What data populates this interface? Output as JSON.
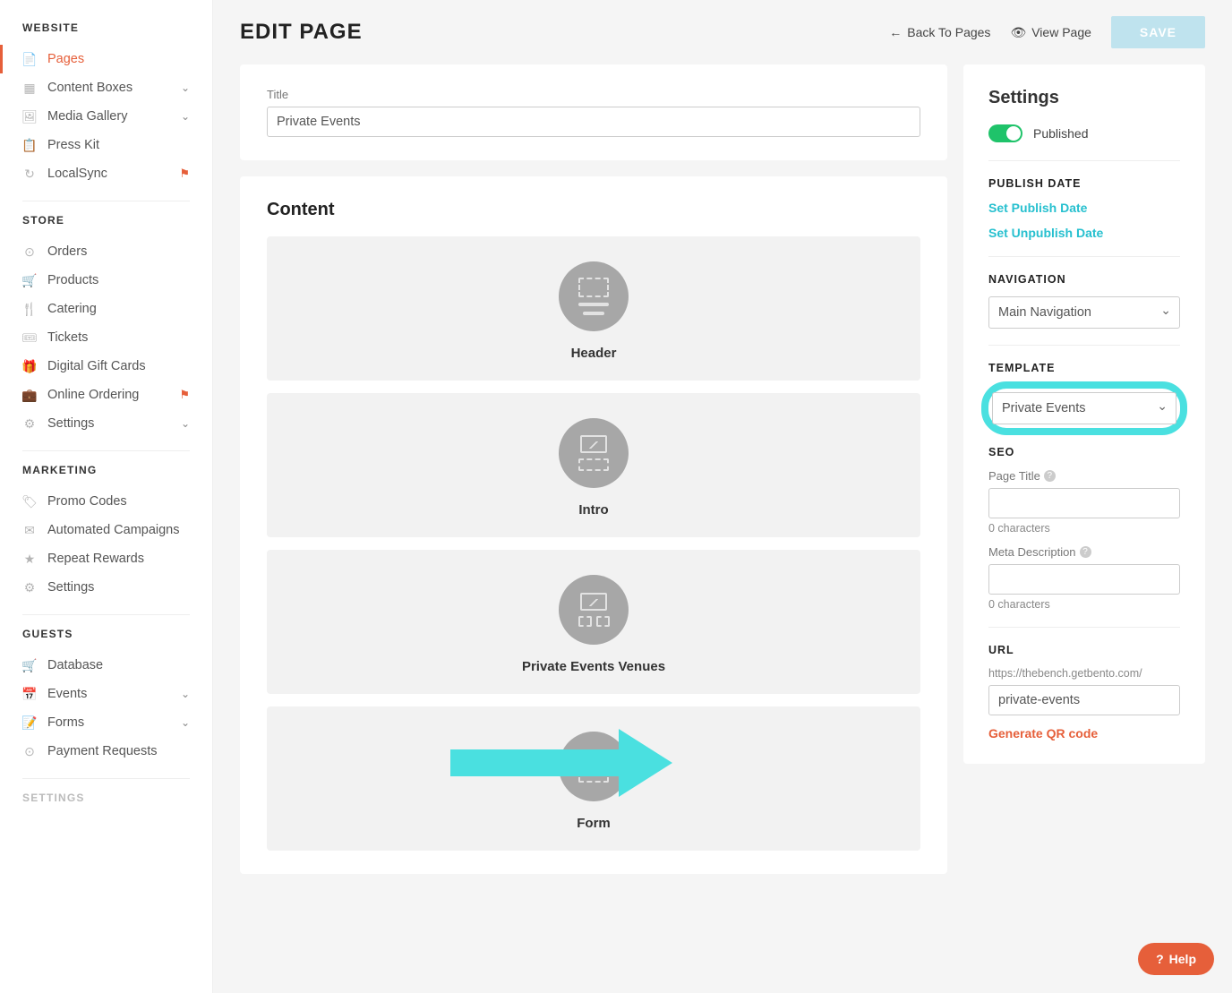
{
  "sidebar": {
    "sections": [
      {
        "heading": "WEBSITE",
        "items": [
          {
            "label": "Pages",
            "icon": "📄",
            "active": true
          },
          {
            "label": "Content Boxes",
            "icon": "▦",
            "chevron": true
          },
          {
            "label": "Media Gallery",
            "icon": "🖼",
            "chevron": true
          },
          {
            "label": "Press Kit",
            "icon": "📋"
          },
          {
            "label": "LocalSync",
            "icon": "↻",
            "flag": true
          }
        ]
      },
      {
        "heading": "STORE",
        "items": [
          {
            "label": "Orders",
            "icon": "⊙"
          },
          {
            "label": "Products",
            "icon": "🛒"
          },
          {
            "label": "Catering",
            "icon": "🍴"
          },
          {
            "label": "Tickets",
            "icon": "🎟"
          },
          {
            "label": "Digital Gift Cards",
            "icon": "🎁"
          },
          {
            "label": "Online Ordering",
            "icon": "💼",
            "flag": true
          },
          {
            "label": "Settings",
            "icon": "⚙",
            "chevron": true
          }
        ]
      },
      {
        "heading": "MARKETING",
        "items": [
          {
            "label": "Promo Codes",
            "icon": "🏷"
          },
          {
            "label": "Automated Campaigns",
            "icon": "✉"
          },
          {
            "label": "Repeat Rewards",
            "icon": "★"
          },
          {
            "label": "Settings",
            "icon": "⚙"
          }
        ]
      },
      {
        "heading": "GUESTS",
        "items": [
          {
            "label": "Database",
            "icon": "🛒"
          },
          {
            "label": "Events",
            "icon": "📅",
            "chevron": true
          },
          {
            "label": "Forms",
            "icon": "📝",
            "chevron": true
          },
          {
            "label": "Payment Requests",
            "icon": "⊙"
          }
        ]
      },
      {
        "heading": "SETTINGS",
        "items": [],
        "muted": true
      }
    ]
  },
  "header": {
    "title": "EDIT PAGE",
    "back": "Back To Pages",
    "view": "View Page",
    "save": "SAVE"
  },
  "titleField": {
    "label": "Title",
    "value": "Private Events"
  },
  "content": {
    "heading": "Content",
    "blocks": [
      {
        "label": "Header",
        "variant": "header"
      },
      {
        "label": "Intro",
        "variant": "intro"
      },
      {
        "label": "Private Events Venues",
        "variant": "venues"
      },
      {
        "label": "Form",
        "variant": "form"
      }
    ]
  },
  "settings": {
    "title": "Settings",
    "published_label": "Published",
    "publish_date_heading": "PUBLISH DATE",
    "set_publish": "Set Publish Date",
    "set_unpublish": "Set Unpublish Date",
    "navigation_heading": "NAVIGATION",
    "navigation_value": "Main Navigation",
    "template_heading": "TEMPLATE",
    "template_value": "Private Events",
    "seo_heading": "SEO",
    "page_title_label": "Page Title",
    "page_title_count": "0 characters",
    "meta_desc_label": "Meta Description",
    "meta_desc_count": "0 characters",
    "url_heading": "URL",
    "url_prefix": "https://thebench.getbento.com/",
    "url_value": "private-events",
    "qr": "Generate QR code"
  },
  "help": "Help"
}
